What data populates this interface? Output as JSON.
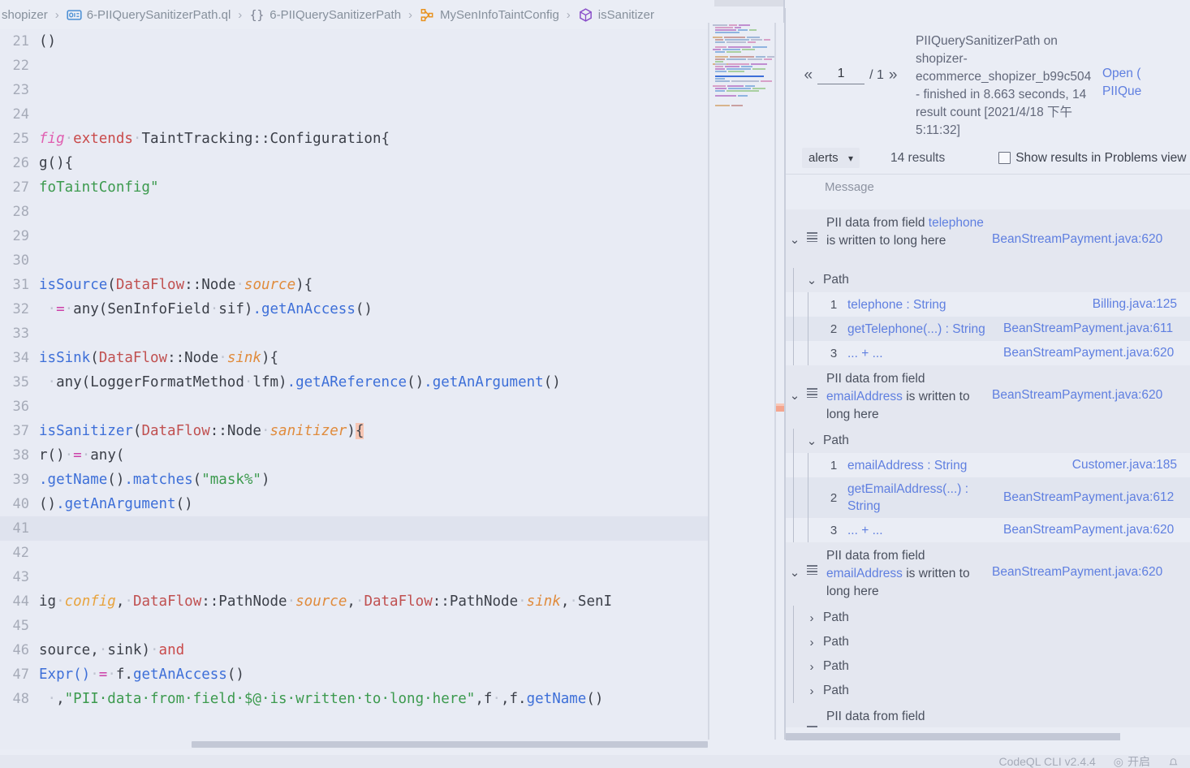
{
  "breadcrumb": [
    {
      "label": "shopizer",
      "icon": ""
    },
    {
      "label": "6-PIIQuerySanitizerPath.ql",
      "icon": "ql-file-icon"
    },
    {
      "label": "6-PIIQuerySanitizerPath",
      "icon": "braces-icon"
    },
    {
      "label": "MySenInfoTaintConfig",
      "icon": "class-icon"
    },
    {
      "label": "isSanitizer",
      "icon": "method-icon"
    }
  ],
  "breadcrumb_separator": "›",
  "editor": {
    "language": "ql",
    "current_line": 41,
    "lines": [
      {
        "num": "21",
        "tokens": [
          {
            "t": "()",
            "c": "t-plain"
          }
        ]
      },
      {
        "num": "22",
        "tokens": []
      },
      {
        "num": "23",
        "tokens": []
      },
      {
        "num": "24",
        "tokens": []
      },
      {
        "num": "25",
        "tokens": [
          {
            "t": "fig",
            "c": "t-pink"
          },
          {
            "t": "·",
            "c": "t-dot"
          },
          {
            "t": "extends",
            "c": "t-kw"
          },
          {
            "t": "·",
            "c": "t-dot"
          },
          {
            "t": "TaintTracking::Configuration{",
            "c": "t-plain"
          }
        ]
      },
      {
        "num": "26",
        "tokens": [
          {
            "t": "g(){",
            "c": "t-plain"
          }
        ]
      },
      {
        "num": "27",
        "tokens": [
          {
            "t": "foTaintConfig\"",
            "c": "t-str"
          }
        ]
      },
      {
        "num": "28",
        "tokens": []
      },
      {
        "num": "29",
        "tokens": []
      },
      {
        "num": "30",
        "tokens": []
      },
      {
        "num": "31",
        "tokens": [
          {
            "t": "isSource",
            "c": "t-fn"
          },
          {
            "t": "(",
            "c": "t-plain"
          },
          {
            "t": "DataFlow",
            "c": "t-type"
          },
          {
            "t": "::Node",
            "c": "t-plain"
          },
          {
            "t": "·",
            "c": "t-dot"
          },
          {
            "t": "source",
            "c": "t-var2"
          },
          {
            "t": "){",
            "c": "t-plain"
          }
        ]
      },
      {
        "num": "32",
        "tokens": [
          {
            "t": " ·",
            "c": "t-dot"
          },
          {
            "t": "=",
            "c": "t-op"
          },
          {
            "t": "·",
            "c": "t-dot"
          },
          {
            "t": "any(SenInfoField",
            "c": "t-plain"
          },
          {
            "t": "·",
            "c": "t-dot"
          },
          {
            "t": "sif)",
            "c": "t-plain"
          },
          {
            "t": ".getAnAccess",
            "c": "t-fn"
          },
          {
            "t": "()",
            "c": "t-plain"
          }
        ]
      },
      {
        "num": "33",
        "tokens": []
      },
      {
        "num": "34",
        "tokens": [
          {
            "t": "isSink",
            "c": "t-fn"
          },
          {
            "t": "(",
            "c": "t-plain"
          },
          {
            "t": "DataFlow",
            "c": "t-type"
          },
          {
            "t": "::Node",
            "c": "t-plain"
          },
          {
            "t": "·",
            "c": "t-dot"
          },
          {
            "t": "sink",
            "c": "t-var2"
          },
          {
            "t": "){",
            "c": "t-plain"
          }
        ]
      },
      {
        "num": "35",
        "tokens": [
          {
            "t": " ·",
            "c": "t-dot"
          },
          {
            "t": "any(LoggerFormatMethod",
            "c": "t-plain"
          },
          {
            "t": "·",
            "c": "t-dot"
          },
          {
            "t": "lfm)",
            "c": "t-plain"
          },
          {
            "t": ".getAReference",
            "c": "t-fn"
          },
          {
            "t": "()",
            "c": "t-plain"
          },
          {
            "t": ".getAnArgument",
            "c": "t-fn"
          },
          {
            "t": "()",
            "c": "t-plain"
          }
        ]
      },
      {
        "num": "36",
        "tokens": []
      },
      {
        "num": "37",
        "tokens": [
          {
            "t": "isSanitizer",
            "c": "t-fn"
          },
          {
            "t": "(",
            "c": "t-plain"
          },
          {
            "t": "DataFlow",
            "c": "t-type"
          },
          {
            "t": "::Node",
            "c": "t-plain"
          },
          {
            "t": "·",
            "c": "t-dot"
          },
          {
            "t": "sanitizer",
            "c": "t-var2"
          },
          {
            "t": ")",
            "c": "t-plain"
          },
          {
            "t": "{",
            "c": "brace-hl"
          }
        ]
      },
      {
        "num": "38",
        "tokens": [
          {
            "t": "r()",
            "c": "t-plain"
          },
          {
            "t": "·",
            "c": "t-dot"
          },
          {
            "t": "=",
            "c": "t-op"
          },
          {
            "t": "·",
            "c": "t-dot"
          },
          {
            "t": "any(",
            "c": "t-plain"
          }
        ]
      },
      {
        "num": "39",
        "tokens": [
          {
            "t": ".getName",
            "c": "t-fn"
          },
          {
            "t": "()",
            "c": "t-plain"
          },
          {
            "t": ".matches",
            "c": "t-fn"
          },
          {
            "t": "(",
            "c": "t-plain"
          },
          {
            "t": "\"mask%\"",
            "c": "t-str"
          },
          {
            "t": ")",
            "c": "t-plain"
          }
        ]
      },
      {
        "num": "40",
        "tokens": [
          {
            "t": "()",
            "c": "t-plain"
          },
          {
            "t": ".getAnArgument",
            "c": "t-fn"
          },
          {
            "t": "()",
            "c": "t-plain"
          }
        ]
      },
      {
        "num": "41",
        "tokens": []
      },
      {
        "num": "42",
        "tokens": []
      },
      {
        "num": "43",
        "tokens": []
      },
      {
        "num": "44",
        "tokens": [
          {
            "t": "ig",
            "c": "t-plain"
          },
          {
            "t": "·",
            "c": "t-dot"
          },
          {
            "t": "config",
            "c": "t-var"
          },
          {
            "t": ",",
            "c": "t-plain"
          },
          {
            "t": "·",
            "c": "t-dot"
          },
          {
            "t": "DataFlow",
            "c": "t-type"
          },
          {
            "t": "::PathNode",
            "c": "t-plain"
          },
          {
            "t": "·",
            "c": "t-dot"
          },
          {
            "t": "source",
            "c": "t-var2"
          },
          {
            "t": ",",
            "c": "t-plain"
          },
          {
            "t": "·",
            "c": "t-dot"
          },
          {
            "t": "DataFlow",
            "c": "t-type"
          },
          {
            "t": "::PathNode",
            "c": "t-plain"
          },
          {
            "t": "·",
            "c": "t-dot"
          },
          {
            "t": "sink",
            "c": "t-var2"
          },
          {
            "t": ",",
            "c": "t-plain"
          },
          {
            "t": "·",
            "c": "t-dot"
          },
          {
            "t": "SenI",
            "c": "t-plain"
          }
        ]
      },
      {
        "num": "45",
        "tokens": []
      },
      {
        "num": "46",
        "tokens": [
          {
            "t": "source,",
            "c": "t-plain"
          },
          {
            "t": "·",
            "c": "t-dot"
          },
          {
            "t": "sink)",
            "c": "t-plain"
          },
          {
            "t": "·",
            "c": "t-dot"
          },
          {
            "t": "and",
            "c": "t-kw"
          }
        ]
      },
      {
        "num": "47",
        "tokens": [
          {
            "t": "Expr()",
            "c": "t-fn"
          },
          {
            "t": "·",
            "c": "t-dot"
          },
          {
            "t": "=",
            "c": "t-op"
          },
          {
            "t": "·",
            "c": "t-dot"
          },
          {
            "t": "f.",
            "c": "t-plain"
          },
          {
            "t": "getAnAccess",
            "c": "t-fn"
          },
          {
            "t": "()",
            "c": "t-plain"
          }
        ]
      },
      {
        "num": "48",
        "tokens": [
          {
            "t": " ·",
            "c": "t-dot"
          },
          {
            "t": ",",
            "c": "t-plain"
          },
          {
            "t": "\"PII·data·from·field·$@·is·written·to·long·here\"",
            "c": "t-str"
          },
          {
            "t": ",f",
            "c": "t-plain"
          },
          {
            "t": "·",
            "c": "t-dot"
          },
          {
            "t": ",f.",
            "c": "t-plain"
          },
          {
            "t": "getName",
            "c": "t-fn"
          },
          {
            "t": "()",
            "c": "t-plain"
          }
        ]
      }
    ]
  },
  "results_panel": {
    "pager": {
      "prev": "«",
      "next": "»",
      "current": "1",
      "total": "/ 1"
    },
    "run_summary": "PIIQuerySanitizerPath on shopizer-ecommerce_shopizer_b99c504 - finished in 8.663 seconds, 14 result count [2021/4/18 下午 5:11:32]",
    "open_links": [
      "Open (",
      "PIIQue"
    ],
    "toolbar": {
      "view_select": "alerts",
      "view_options": [
        "alerts"
      ],
      "result_count": "14 results",
      "problems_checkbox_label": "Show results in Problems view",
      "problems_checkbox_checked": false
    },
    "column_header": "Message",
    "path_label": "Path",
    "alerts": [
      {
        "expanded": true,
        "message_prefix": "PII data from field ",
        "message_link": "telephone",
        "message_suffix": " is written to long here",
        "location": "BeanStreamPayment.java:620",
        "paths": [
          {
            "expanded": true,
            "steps": [
              {
                "index": "1",
                "text": "telephone : String",
                "location": "Billing.java:125"
              },
              {
                "index": "2",
                "text": "getTelephone(...) : String",
                "location": "BeanStreamPayment.java:611"
              },
              {
                "index": "3",
                "text": "... + ...",
                "location": "BeanStreamPayment.java:620"
              }
            ]
          }
        ]
      },
      {
        "expanded": true,
        "message_prefix": "PII data from field ",
        "message_link": "emailAddress",
        "message_suffix": " is written to long here",
        "location": "BeanStreamPayment.java:620",
        "paths": [
          {
            "expanded": true,
            "steps": [
              {
                "index": "1",
                "text": "emailAddress : String",
                "location": "Customer.java:185"
              },
              {
                "index": "2",
                "text": "getEmailAddress(...) : String",
                "location": "BeanStreamPayment.java:612"
              },
              {
                "index": "3",
                "text": "... + ...",
                "location": "BeanStreamPayment.java:620"
              }
            ]
          }
        ]
      },
      {
        "expanded": true,
        "message_prefix": "PII data from field ",
        "message_link": "emailAddress",
        "message_suffix": " is written to long here",
        "location": "BeanStreamPayment.java:620",
        "collapsed_paths": [
          "Path",
          "Path",
          "Path",
          "Path"
        ]
      },
      {
        "expanded": false,
        "message_prefix": "PII data from field",
        "message_link": "",
        "message_suffix": "",
        "location": ""
      }
    ]
  },
  "statusbar": {
    "codeql_version": "CodeQL CLI v2.4.4",
    "ime_status": "开启",
    "notification": "bell"
  }
}
